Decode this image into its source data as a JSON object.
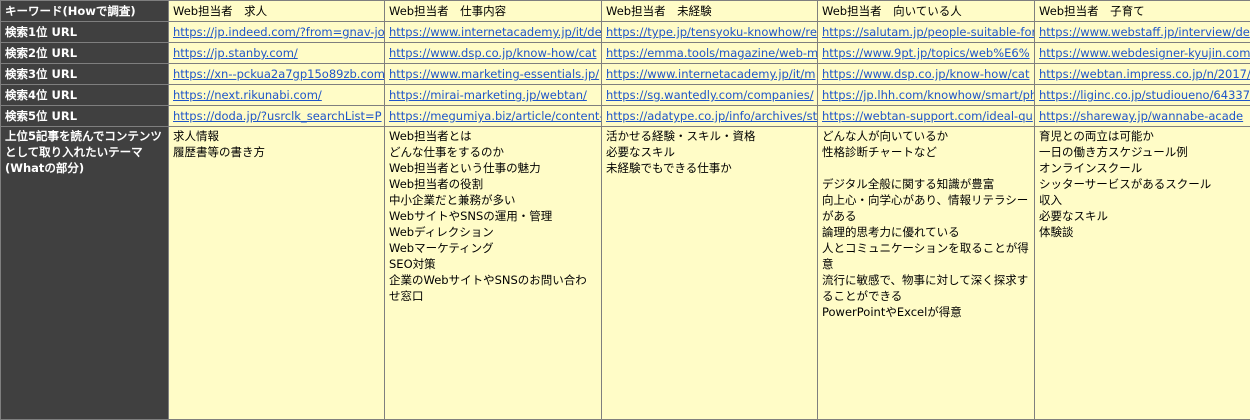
{
  "header": {
    "label": "キーワード(Howで調査)",
    "keywords": [
      "Web担当者　求人",
      "Web担当者　仕事内容",
      "Web担当者　未経験",
      "Web担当者　向いている人",
      "Web担当者　子育て"
    ]
  },
  "url_rows": [
    {
      "label": "検索1位 URL",
      "urls": [
        "https://jp.indeed.com/?from=gnav-jo",
        "https://www.internetacademy.jp/it/de",
        "https://type.jp/tensyoku-knowhow/re",
        "https://salutam.jp/people-suitable-for",
        "https://www.webstaff.jp/interview/de"
      ]
    },
    {
      "label": "検索2位 URL",
      "urls": [
        "https://jp.stanby.com/",
        "https://www.dsp.co.jp/know-how/cat",
        "https://emma.tools/magazine/web-m",
        "https://www.9pt.jp/topics/web%E6%",
        "https://www.webdesigner-kyujin.com"
      ]
    },
    {
      "label": "検索3位 URL",
      "urls": [
        "https://xn--pckua2a7gp15o89zb.com",
        "https://www.marketing-essentials.jp/",
        "https://www.internetacademy.jp/it/m",
        "https://www.dsp.co.jp/know-how/cat",
        "https://webtan.impress.co.jp/n/2017/"
      ]
    },
    {
      "label": "検索4位 URL",
      "urls": [
        "https://next.rikunabi.com/",
        "https://mirai-marketing.jp/webtan/",
        "https://sg.wantedly.com/companies/",
        "https://jp.lhh.com/knowhow/smart/ph",
        "https://liginc.co.jp/studioueno/64337"
      ]
    },
    {
      "label": "検索5位 URL",
      "urls": [
        "https://doda.jp/?usrclk_searchList=P",
        "https://megumiya.biz/article/content-",
        "https://adatype.co.jp/info/archives/st",
        "https://webtan-support.com/ideal-qu",
        "https://shareway.jp/wannabe-acade"
      ]
    }
  ],
  "theme_row": {
    "label": "上位5記事を読んでコンテンツとして取り入れたいテーマ(Whatの部分)",
    "columns": [
      [
        "求人情報",
        "履歴書等の書き方"
      ],
      [
        "Web担当者とは",
        "どんな仕事をするのか",
        "Web担当者という仕事の魅力",
        "Web担当者の役割",
        "中小企業だと兼務が多い",
        "WebサイトやSNSの運用・管理",
        "Webディレクション",
        "Webマーケティング",
        "SEO対策",
        "企業のWebサイトやSNSのお問い合わせ窓口"
      ],
      [
        "活かせる経験・スキル・資格",
        "必要なスキル",
        "未経験でもできる仕事か"
      ],
      [
        "どんな人が向いているか",
        "性格診断チャートなど",
        "",
        "デジタル全般に関する知識が豊富",
        "向上心・向学心があり、情報リテラシーがある",
        "論理的思考力に優れている",
        "人とコミュニケーションを取ることが得意",
        "流行に敏感で、物事に対して深く探求することができる",
        "PowerPointやExcelが得意"
      ],
      [
        "育児との両立は可能か",
        "一日の働き方スケジュール例",
        "オンラインスクール",
        "シッターサービスがあるスクール",
        "収入",
        "必要なスキル",
        "体験談"
      ]
    ]
  }
}
